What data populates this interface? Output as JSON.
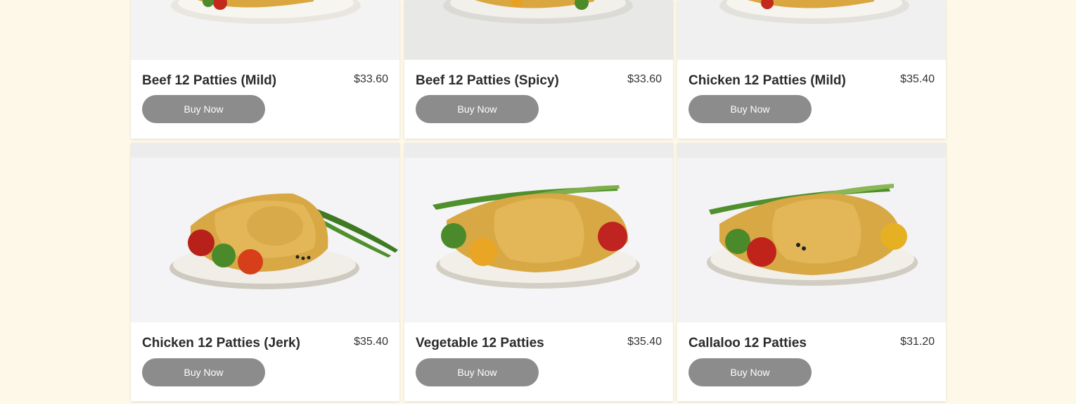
{
  "products": [
    {
      "name": "Beef 12 Patties (Mild)",
      "price": "$33.60",
      "button": "Buy Now",
      "image": "patty-plate-image"
    },
    {
      "name": "Beef 12 Patties (Spicy)",
      "price": "$33.60",
      "button": "Buy Now",
      "image": "patty-plate-image"
    },
    {
      "name": "Chicken 12 Patties (Mild)",
      "price": "$35.40",
      "button": "Buy Now",
      "image": "patty-plate-image"
    },
    {
      "name": "Chicken 12 Patties (Jerk)",
      "price": "$35.40",
      "button": "Buy Now",
      "image": "patty-plate-image"
    },
    {
      "name": "Vegetable 12 Patties",
      "price": "$35.40",
      "button": "Buy Now",
      "image": "patty-plate-image"
    },
    {
      "name": "Callaloo 12 Patties",
      "price": "$31.20",
      "button": "Buy Now",
      "image": "patty-plate-image"
    }
  ],
  "colors": {
    "page_background": "#fdf8e8",
    "card_background": "#ffffff",
    "button_background": "#8c8c8c",
    "button_text": "#ffffff",
    "title_text": "#2b2b2b"
  }
}
